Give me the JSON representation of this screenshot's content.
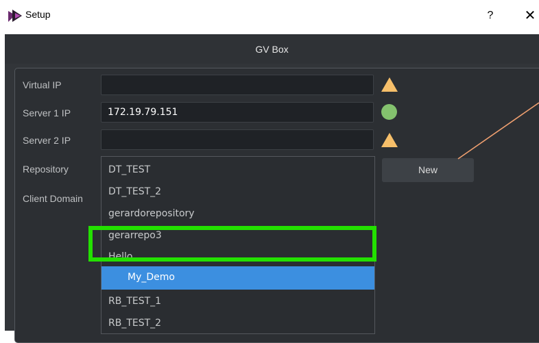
{
  "window": {
    "title": "Setup",
    "help_label": "?",
    "close_label": "✕"
  },
  "dialog": {
    "header_title": "GV Box",
    "fields": {
      "virtual_ip": {
        "label": "Virtual IP",
        "value": "",
        "status": "warning"
      },
      "server1_ip": {
        "label": "Server 1 IP",
        "value": "172.19.79.151",
        "status": "ok"
      },
      "server2_ip": {
        "label": "Server 2 IP",
        "value": "",
        "status": "warning"
      }
    },
    "repository_label": "Repository",
    "client_domain_label": "Client Domain",
    "new_button": "New",
    "repository_options": [
      "DT_TEST",
      "DT_TEST_2",
      "gerardorepository",
      "gerarrepo3",
      "Hello",
      "My_Demo",
      "RB_TEST_1",
      "RB_TEST_2"
    ],
    "selected_option": "My_Demo"
  },
  "colors": {
    "warning": "#f6bf6a",
    "ok": "#84c26e",
    "selection": "#3c8fe0",
    "highlight": "#23e000",
    "callout_line": "#f0a070"
  }
}
